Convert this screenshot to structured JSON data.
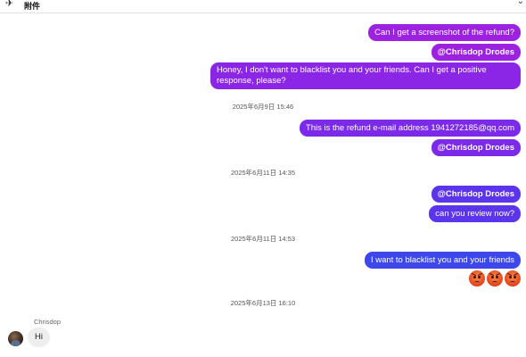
{
  "header": {
    "title": "附件"
  },
  "messages": {
    "m1": "Can I get a screenshot of the refund?",
    "m2": "@Chrisdop Drodes",
    "m3": "Honey, I don't want to blacklist you and your friends. Can I get a positive response, please?",
    "ts1": "2025年6月9日 15:46",
    "m4": "This is the refund e-mail address 1941272185@qq.com",
    "m5": "@Chrisdop Drodes",
    "ts2": "2025年6月11日 14:35",
    "m6": "@Chrisdop Drodes",
    "m7": "can you  review now?",
    "ts3": "2025年6月11日 14:53",
    "m8": "I want to blacklist you and your friends",
    "emojis": [
      "angry-face-icon",
      "angry-face-icon",
      "angry-face-icon"
    ],
    "ts4": "2025年6月13日 16:10"
  },
  "incoming": {
    "sender": "Chrisdop",
    "text": "Hi"
  },
  "colors": {
    "bubble_purple": "#9d22e0",
    "bubble_violet": "#7a2ae8",
    "bubble_blue": "#3e48ea",
    "incoming_bg": "#eeeeee"
  }
}
